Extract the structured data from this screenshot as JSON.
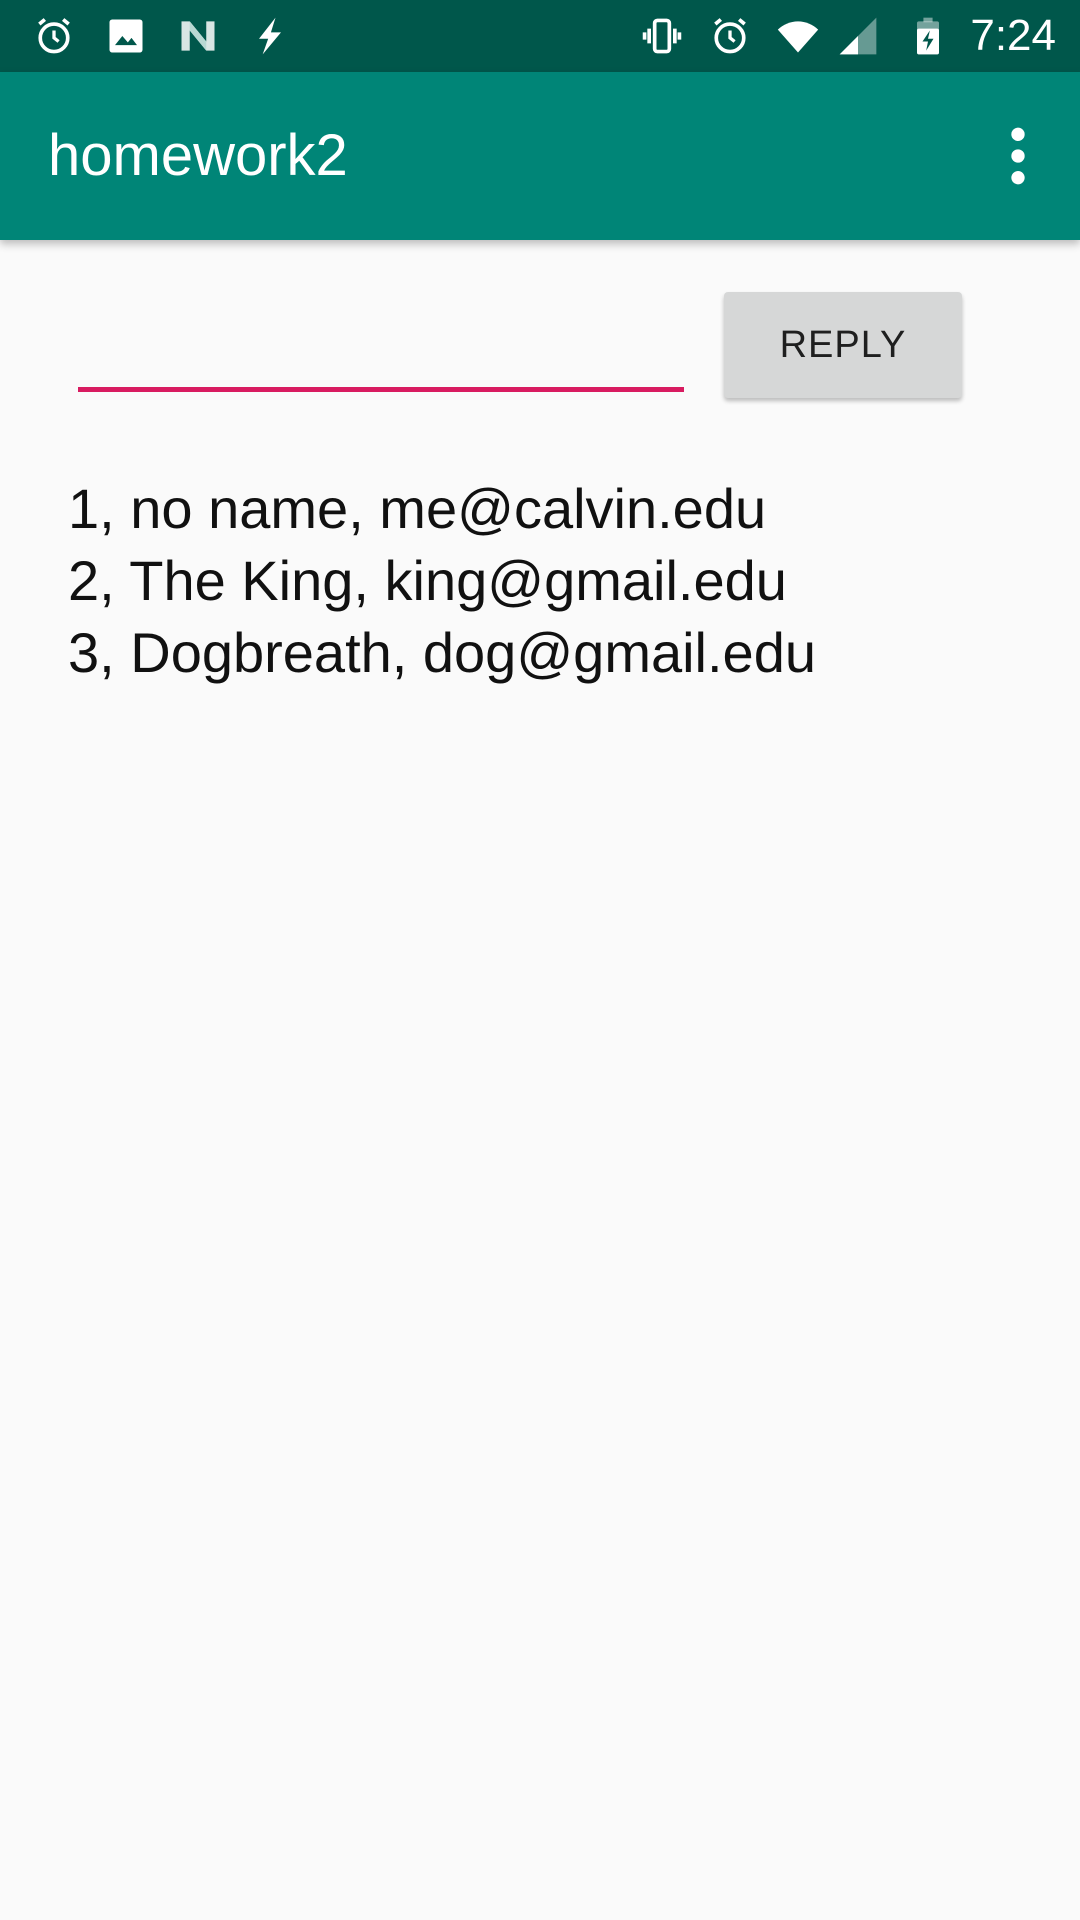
{
  "status_bar": {
    "time": "7:24",
    "left_icons": [
      "alarm-icon",
      "image-icon",
      "n-logo-icon",
      "flash-icon"
    ],
    "right_icons": [
      "vibrate-icon",
      "alarm-icon",
      "wifi-icon",
      "cell-signal-icon",
      "battery-charging-icon"
    ],
    "background": "#00574b"
  },
  "app_bar": {
    "title": "homework2",
    "menu_icon": "more-vert-icon",
    "background": "#008577"
  },
  "form": {
    "input_value": "",
    "input_underline_color": "#d81b60",
    "reply_label": "REPLY"
  },
  "results": [
    "1, no name, me@calvin.edu",
    "2, The King, king@gmail.edu",
    "3, Dogbreath, dog@gmail.edu"
  ]
}
